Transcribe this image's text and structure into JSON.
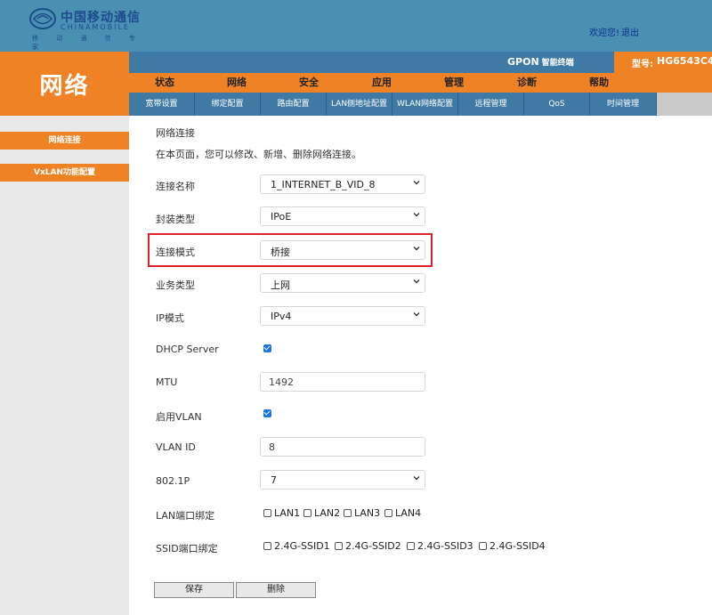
{
  "brand": {
    "name_cn": "中国移动通信",
    "name_en": "CHINAMOBILE",
    "slogan": "移 动 通 信 专 家"
  },
  "header": {
    "welcome": "欢迎您!",
    "logout": "退出",
    "product": "GPON",
    "product_sub": "智能终端",
    "model_label": "型号:",
    "model_value": "HG6543C4"
  },
  "section_title": "网络",
  "main_nav": [
    "状态",
    "网络",
    "安全",
    "应用",
    "管理",
    "诊断",
    "帮助"
  ],
  "sub_nav": [
    "宽带设置",
    "绑定配置",
    "路由配置",
    "LAN侧地址配置",
    "WLAN网络配置",
    "远程管理",
    "QoS",
    "时间管理"
  ],
  "sidebar": [
    "网络连接",
    "VxLAN功能配置"
  ],
  "content": {
    "title": "网络连接",
    "description": "在本页面，您可以修改、新增、删除网络连接。",
    "connection_name_label": "连接名称",
    "connection_name_value": "1_INTERNET_B_VID_8",
    "encap_label": "封装类型",
    "encap_value": "IPoE",
    "mode_label": "连接模式",
    "mode_value": "桥接",
    "service_label": "业务类型",
    "service_value": "上网",
    "ip_mode_label": "IP模式",
    "ip_mode_value": "IPv4",
    "dhcp_label": "DHCP Server",
    "dhcp_checked": true,
    "mtu_label": "MTU",
    "mtu_value": "1492",
    "vlan_enable_label": "启用VLAN",
    "vlan_enable_checked": true,
    "vlan_id_label": "VLAN ID",
    "vlan_id_value": "8",
    "dot1p_label": "802.1P",
    "dot1p_value": "7",
    "lan_bind_label": "LAN端口绑定",
    "lan_ports": [
      "LAN1",
      "LAN2",
      "LAN3",
      "LAN4"
    ],
    "ssid_bind_label": "SSID端口绑定",
    "ssids": [
      "2.4G-SSID1",
      "2.4G-SSID2",
      "2.4G-SSID3",
      "2.4G-SSID4"
    ],
    "save_label": "保存",
    "delete_label": "删除"
  },
  "colors": {
    "orange": "#ee8224",
    "blue": "#3f7aa4",
    "highlight": "#e0212b"
  }
}
